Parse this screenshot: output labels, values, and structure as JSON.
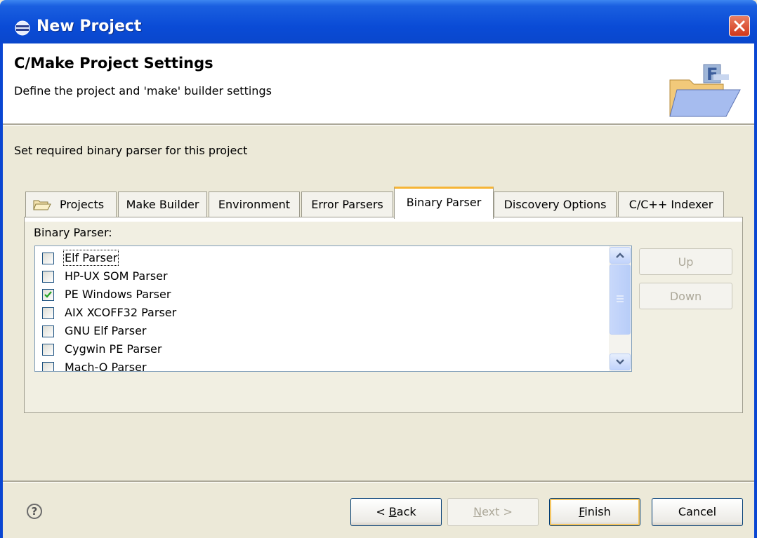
{
  "window": {
    "title": "New Project"
  },
  "header": {
    "title": "C/Make Project Settings",
    "description": "Define the project and 'make' builder settings"
  },
  "instruction": "Set required binary parser for this project",
  "tabs": [
    {
      "label": "Projects",
      "active": false
    },
    {
      "label": "Make Builder",
      "active": false
    },
    {
      "label": "Environment",
      "active": false
    },
    {
      "label": "Error Parsers",
      "active": false
    },
    {
      "label": "Binary Parser",
      "active": true
    },
    {
      "label": "Discovery Options",
      "active": false
    },
    {
      "label": "C/C++ Indexer",
      "active": false
    }
  ],
  "binary_parser": {
    "label": "Binary Parser:",
    "items": [
      {
        "label": "Elf Parser",
        "checked": false
      },
      {
        "label": "HP-UX SOM Parser",
        "checked": false
      },
      {
        "label": "PE Windows Parser",
        "checked": true
      },
      {
        "label": "AIX XCOFF32 Parser",
        "checked": false
      },
      {
        "label": "GNU Elf Parser",
        "checked": false
      },
      {
        "label": "Cygwin PE Parser",
        "checked": false
      },
      {
        "label": "Mach-O Parser",
        "checked": false
      }
    ],
    "up_label": "Up",
    "down_label": "Down"
  },
  "buttons": {
    "back": {
      "pre": "< ",
      "mnemonic": "B",
      "rest": "ack"
    },
    "next": {
      "mnemonic": "N",
      "rest": "ext >"
    },
    "finish": {
      "mnemonic": "F",
      "rest": "inish"
    },
    "cancel": "Cancel",
    "help": "?"
  }
}
